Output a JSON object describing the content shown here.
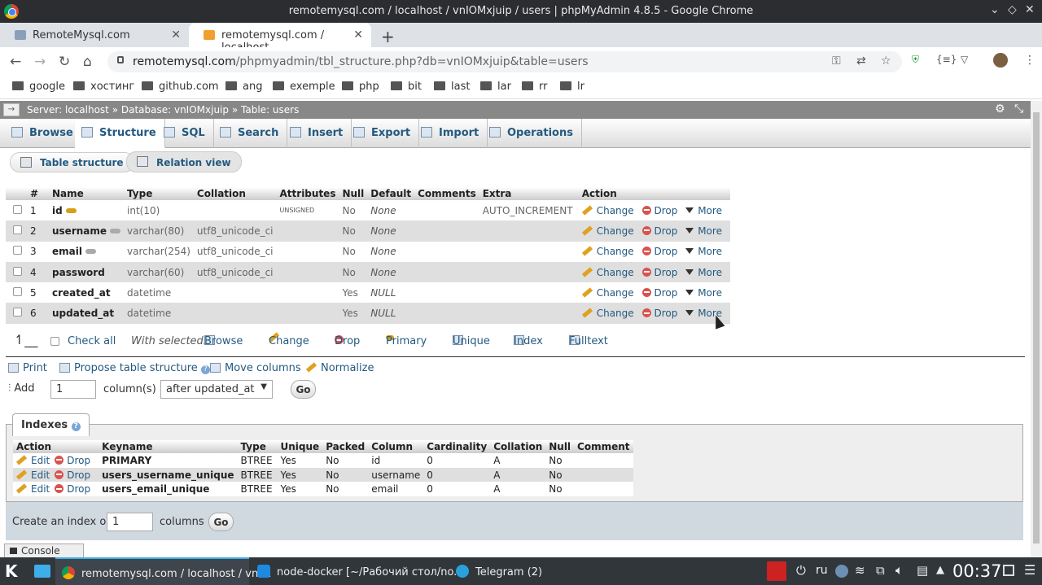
{
  "window": {
    "title": "remotemysql.com / localhost / vnIOMxjuip / users | phpMyAdmin 4.8.5 - Google Chrome"
  },
  "tabs": [
    {
      "label": "RemoteMysql.com",
      "active": false
    },
    {
      "label": "remotemysql.com / localhost",
      "active": true
    }
  ],
  "address": {
    "domain": "remotemysql.com",
    "path": "/phpmyadmin/tbl_structure.php?db=vnIOMxjuip&table=users"
  },
  "bookmarks": [
    "google",
    "хостинг",
    "github.com",
    "ang",
    "exemple",
    "php",
    "bit",
    "last",
    "lar",
    "rr",
    "lr"
  ],
  "breadcrumb": {
    "server": "Server: localhost",
    "database": "Database: vnIOMxjuip",
    "table": "Table: users"
  },
  "menu": [
    {
      "label": "Browse",
      "active": false
    },
    {
      "label": "Structure",
      "active": true
    },
    {
      "label": "SQL",
      "active": false
    },
    {
      "label": "Search",
      "active": false
    },
    {
      "label": "Insert",
      "active": false
    },
    {
      "label": "Export",
      "active": false
    },
    {
      "label": "Import",
      "active": false
    },
    {
      "label": "Operations",
      "active": false
    }
  ],
  "subtabs": {
    "table_structure": "Table structure",
    "relation_view": "Relation view"
  },
  "structure": {
    "headers": [
      "#",
      "Name",
      "Type",
      "Collation",
      "Attributes",
      "Null",
      "Default",
      "Comments",
      "Extra",
      "Action"
    ],
    "rows": [
      {
        "num": "1",
        "name": "id",
        "type": "int(10)",
        "collation": "",
        "attributes": "UNSIGNED",
        "null": "No",
        "default": "None",
        "comments": "",
        "extra": "AUTO_INCREMENT"
      },
      {
        "num": "2",
        "name": "username",
        "type": "varchar(80)",
        "collation": "utf8_unicode_ci",
        "attributes": "",
        "null": "No",
        "default": "None",
        "comments": "",
        "extra": ""
      },
      {
        "num": "3",
        "name": "email",
        "type": "varchar(254)",
        "collation": "utf8_unicode_ci",
        "attributes": "",
        "null": "No",
        "default": "None",
        "comments": "",
        "extra": ""
      },
      {
        "num": "4",
        "name": "password",
        "type": "varchar(60)",
        "collation": "utf8_unicode_ci",
        "attributes": "",
        "null": "No",
        "default": "None",
        "comments": "",
        "extra": ""
      },
      {
        "num": "5",
        "name": "created_at",
        "type": "datetime",
        "collation": "",
        "attributes": "",
        "null": "Yes",
        "default": "NULL",
        "comments": "",
        "extra": ""
      },
      {
        "num": "6",
        "name": "updated_at",
        "type": "datetime",
        "collation": "",
        "attributes": "",
        "null": "Yes",
        "default": "NULL",
        "comments": "",
        "extra": ""
      }
    ],
    "actions": {
      "change": "Change",
      "drop": "Drop",
      "more": "More"
    }
  },
  "with_selected": {
    "check_all": "Check all",
    "label": "With selected:",
    "browse": "Browse",
    "change": "Change",
    "drop": "Drop",
    "primary": "Primary",
    "unique": "Unique",
    "index": "Index",
    "fulltext": "Fulltext"
  },
  "tools": {
    "print": "Print",
    "propose": "Propose table structure",
    "move": "Move columns",
    "normalize": "Normalize"
  },
  "add_columns": {
    "label": "Add",
    "count": "1",
    "unit": "column(s)",
    "position": "after updated_at",
    "go": "Go"
  },
  "indexes": {
    "title": "Indexes",
    "headers": [
      "Action",
      "Keyname",
      "Type",
      "Unique",
      "Packed",
      "Column",
      "Cardinality",
      "Collation",
      "Null",
      "Comment"
    ],
    "rows": [
      {
        "keyname": "PRIMARY",
        "type": "BTREE",
        "unique": "Yes",
        "packed": "No",
        "column": "id",
        "cardinality": "0",
        "collation": "A",
        "null": "No",
        "comment": ""
      },
      {
        "keyname": "users_username_unique",
        "type": "BTREE",
        "unique": "Yes",
        "packed": "No",
        "column": "username",
        "cardinality": "0",
        "collation": "A",
        "null": "No",
        "comment": ""
      },
      {
        "keyname": "users_email_unique",
        "type": "BTREE",
        "unique": "Yes",
        "packed": "No",
        "column": "email",
        "cardinality": "0",
        "collation": "A",
        "null": "No",
        "comment": ""
      }
    ],
    "edit": "Edit",
    "drop": "Drop",
    "create_label": "Create an index on",
    "create_count": "1",
    "create_unit": "columns",
    "go": "Go"
  },
  "console": "Console",
  "taskbar": {
    "items": [
      "remotemysql.com / localhost / vnI...",
      "node-docker [~/Рабочий стол/no...",
      "Telegram (2)"
    ],
    "lang": "ru",
    "clock": "00:37"
  }
}
